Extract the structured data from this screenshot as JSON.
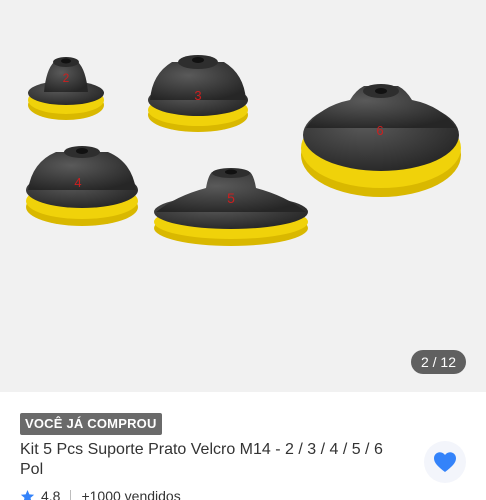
{
  "gallery": {
    "counter": "2 / 12",
    "pad_labels": [
      "2",
      "3",
      "4",
      "5",
      "6"
    ],
    "colors": {
      "rubber": "#3a3a3a",
      "foam": "#f0d20a",
      "label": "#cc1f1f"
    }
  },
  "product": {
    "badge": "VOCÊ JÁ COMPROU",
    "title": "Kit 5 Pcs Suporte Prato Velcro M14 - 2 / 3 / 4 / 5 / 6 Pol",
    "rating": "4.8",
    "sold": "+1000 vendidos"
  },
  "icons": {
    "favorite": "heart-icon",
    "rating": "star-icon"
  },
  "colors": {
    "accent": "#3483fa",
    "badge_bg": "#6a6a6a"
  }
}
